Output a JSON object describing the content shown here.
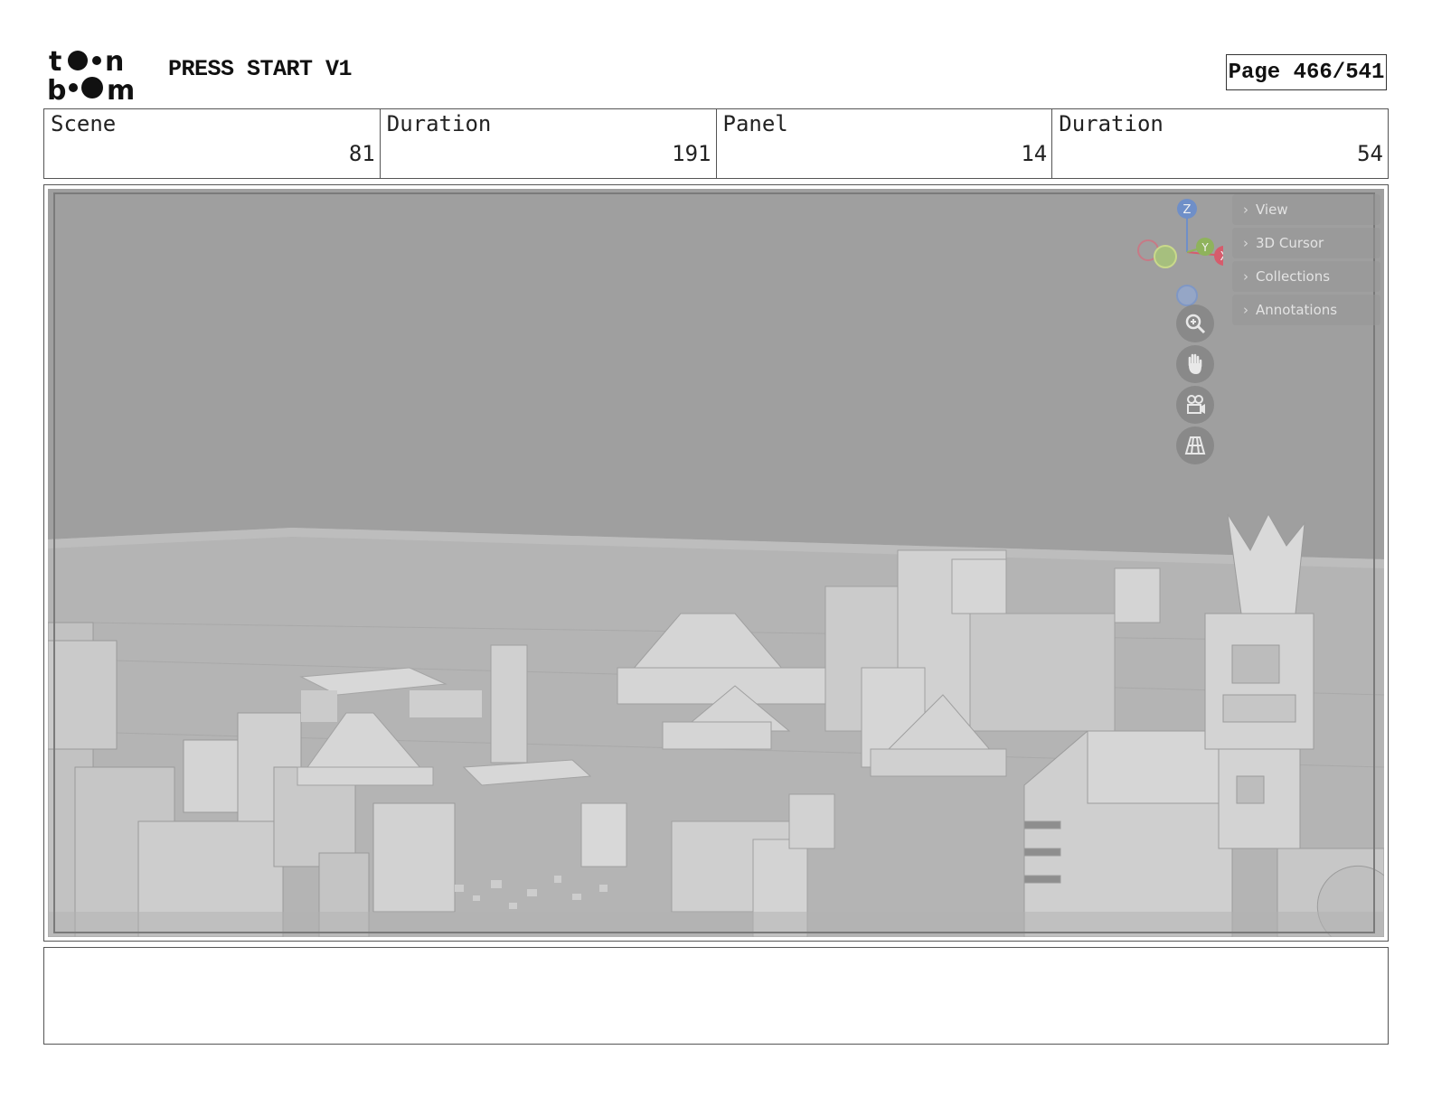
{
  "header": {
    "logo_text": "toon boom",
    "title": "PRESS START V1",
    "page_indicator": "Page 466/541"
  },
  "info": {
    "scene_label": "Scene",
    "scene_value": "81",
    "scene_duration_label": "Duration",
    "scene_duration_value": "191",
    "panel_label": "Panel",
    "panel_value": "14",
    "panel_duration_label": "Duration",
    "panel_duration_value": "54"
  },
  "viewport": {
    "side_panel": [
      "View",
      "3D Cursor",
      "Collections",
      "Annotations"
    ],
    "gizmo_axes": {
      "z": "Z",
      "y": "Y",
      "x": "X"
    },
    "nav_buttons": [
      "zoom-icon",
      "pan-hand-icon",
      "camera-icon",
      "perspective-grid-icon"
    ],
    "colors": {
      "z_axis": "#6f8fc8",
      "y_axis": "#8fb35c",
      "x_axis": "#d65c6c",
      "background": "#9e9e9e"
    }
  },
  "notes": {
    "text": ""
  }
}
